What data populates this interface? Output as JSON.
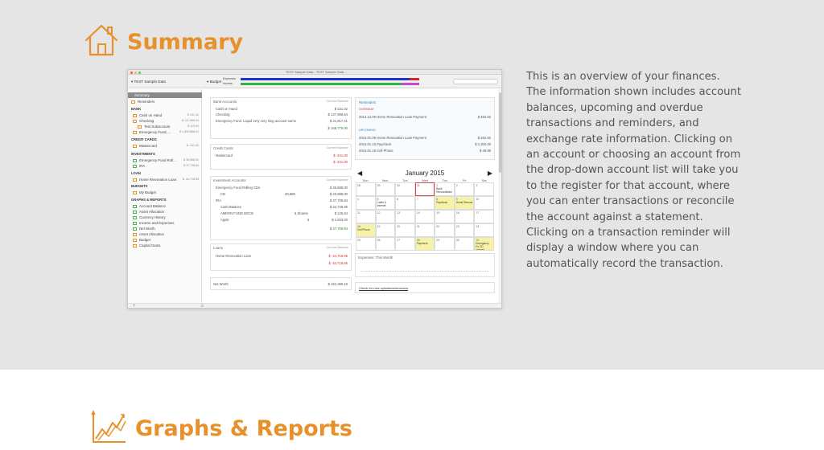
{
  "summary": {
    "title": "Summary",
    "icon": "house-icon",
    "description": "This is an overview of your finances. The information shown includes account balances, upcoming and overdue transactions and reminders, and exchange rate information. Clicking on an account or choosing an account from the drop-down account list will take you to the register for that account, where you can enter transactions or reconcile the account against a statement. Clicking on a transaction reminder will display a window where you can automatically record the transaction."
  },
  "graphs": {
    "title": "Graphs & Reports",
    "icon": "chart-trend-icon"
  },
  "screenshot": {
    "window_title": "TEST Sample Data - TEST Sample Data",
    "account_selector": "TEST Sample Data",
    "budget_label": "Budget",
    "expense_label": "Expenses",
    "income_label": "Income",
    "sidebar": {
      "items": [
        {
          "label": "Summary"
        },
        {
          "label": "Reminders"
        }
      ],
      "bank_header": "BANK",
      "bank": [
        {
          "label": "Cash on Hand",
          "value": "$ 131.32"
        },
        {
          "label": "Checking",
          "value": "$ 137,986.54"
        },
        {
          "label": "Test Subaccount",
          "value": "$ 113.00"
        },
        {
          "label": "Emergency Fund, ...",
          "value": "$ 1,053,868.01"
        }
      ],
      "cc_header": "CREDIT CARDS",
      "cc": [
        {
          "label": "Mastercard",
          "value": "$ -241.00"
        }
      ],
      "inv_header": "INVESTMENTS",
      "inv": [
        {
          "label": "Emergency Fund Roll...",
          "value": "$ 36,888.00"
        },
        {
          "label": "IRA",
          "value": "$ 37,708.84"
        }
      ],
      "loan_header": "LOAN",
      "loan": [
        {
          "label": "Home Renovation Loan",
          "value": "$ -44,718.85"
        }
      ],
      "budgets_header": "BUDGETS",
      "budgets": [
        {
          "label": "My Budget"
        }
      ],
      "graphs_header": "GRAPHS & REPORTS",
      "graphs": [
        {
          "label": "Account Balance"
        },
        {
          "label": "Asset Allocation"
        },
        {
          "label": "Currency History"
        },
        {
          "label": "Income and Expenses"
        },
        {
          "label": "Net Worth"
        },
        {
          "label": "Asset Allocation"
        },
        {
          "label": "Budget"
        },
        {
          "label": "Capital Gains"
        }
      ]
    },
    "bank_panel": {
      "title": "Bank Accounts",
      "right": "Current Balance",
      "rows": [
        {
          "label": "Cash on Hand",
          "value": "$ 131.32"
        },
        {
          "label": "Checking",
          "value": "$ 137,986.54"
        },
        {
          "label": "Emergency Fund, Liquid very very long account name",
          "value": "$ 31,917.41"
        },
        {
          "label": "",
          "value": "$ 169,775.00"
        }
      ]
    },
    "cc_panel": {
      "title": "Credit Cards",
      "right": "Current Balance",
      "rows": [
        {
          "label": "Mastercard",
          "value": "$ -241.00"
        },
        {
          "label": "",
          "value": "$ -241.00"
        }
      ]
    },
    "inv_panel": {
      "title": "Investment Accounts",
      "right": "Current Balance",
      "rows": [
        {
          "label": "Emergency Fund Rolling CDs",
          "value": "$ 36,888.00"
        },
        {
          "label": "CD",
          "mid": "20,888",
          "value": "$ 20,888.00"
        },
        {
          "label": "IRA",
          "value": "$ 37,708.84"
        },
        {
          "label": "Cash Balance",
          "value": "$ 34,748.90"
        },
        {
          "label": "AMERN FUND BOCB",
          "mid": "6 Shares",
          "value": "$ 125.94"
        },
        {
          "label": "Apple",
          "mid": "5",
          "value": "$ 2,833.00"
        },
        {
          "label": "",
          "value": "$ 37,708.84"
        }
      ]
    },
    "loans_panel": {
      "title": "Loans",
      "right": "Current Balance",
      "rows": [
        {
          "label": "Home Renovation Loan",
          "value": "$ -44,718.85"
        },
        {
          "label": "",
          "value": "$ -44,718.85"
        }
      ]
    },
    "networth": {
      "label": "Net Worth",
      "value": "$ 162,380.19"
    },
    "reminders": {
      "title": "Reminders",
      "overdue_label": "OVERDUE",
      "overdue": [
        {
          "date": "2014.12.09",
          "desc": "Home Renovation Loan Payment",
          "amount": "$ 482.92"
        }
      ],
      "upcoming_label": "UPCOMING",
      "upcoming": [
        {
          "date": "2015.01.09",
          "desc": "Home Renovation Loan Payment",
          "amount": "$ 482.92"
        },
        {
          "date": "2015.01.15",
          "desc": "Paycheck",
          "amount": "$ 2,300.00"
        },
        {
          "date": "2015.01.19",
          "desc": "Cell Phone",
          "amount": "$ 49.99"
        }
      ]
    },
    "calendar": {
      "month": "January 2015",
      "dow": [
        "Sun",
        "Mon",
        "Tue",
        "Wed",
        "Thu",
        "Fri",
        "Sat"
      ],
      "weeks": [
        [
          "28",
          "29",
          "30",
          "31",
          "1",
          "2",
          "3"
        ],
        [
          "4",
          "5",
          "6",
          "7",
          "8",
          "9",
          "10"
        ],
        [
          "11",
          "12",
          "13",
          "14",
          "15",
          "16",
          "17"
        ],
        [
          "18",
          "19",
          "20",
          "21",
          "22",
          "23",
          "24"
        ],
        [
          "25",
          "26",
          "27",
          "28",
          "29",
          "30",
          "31"
        ]
      ],
      "notes": {
        "0-4": "Bank Reconciliation",
        "1-1": "Cable & Internet",
        "1-4": "Paycheck",
        "1-5": "Home Renova",
        "3-0": "Cell Phone",
        "4-3": "Paycheck",
        "4-6": "Emergency Fu CD Interest"
      }
    },
    "expenses_title": "Expenses: This Month",
    "updates_link": "Check for new updates/extensions"
  }
}
